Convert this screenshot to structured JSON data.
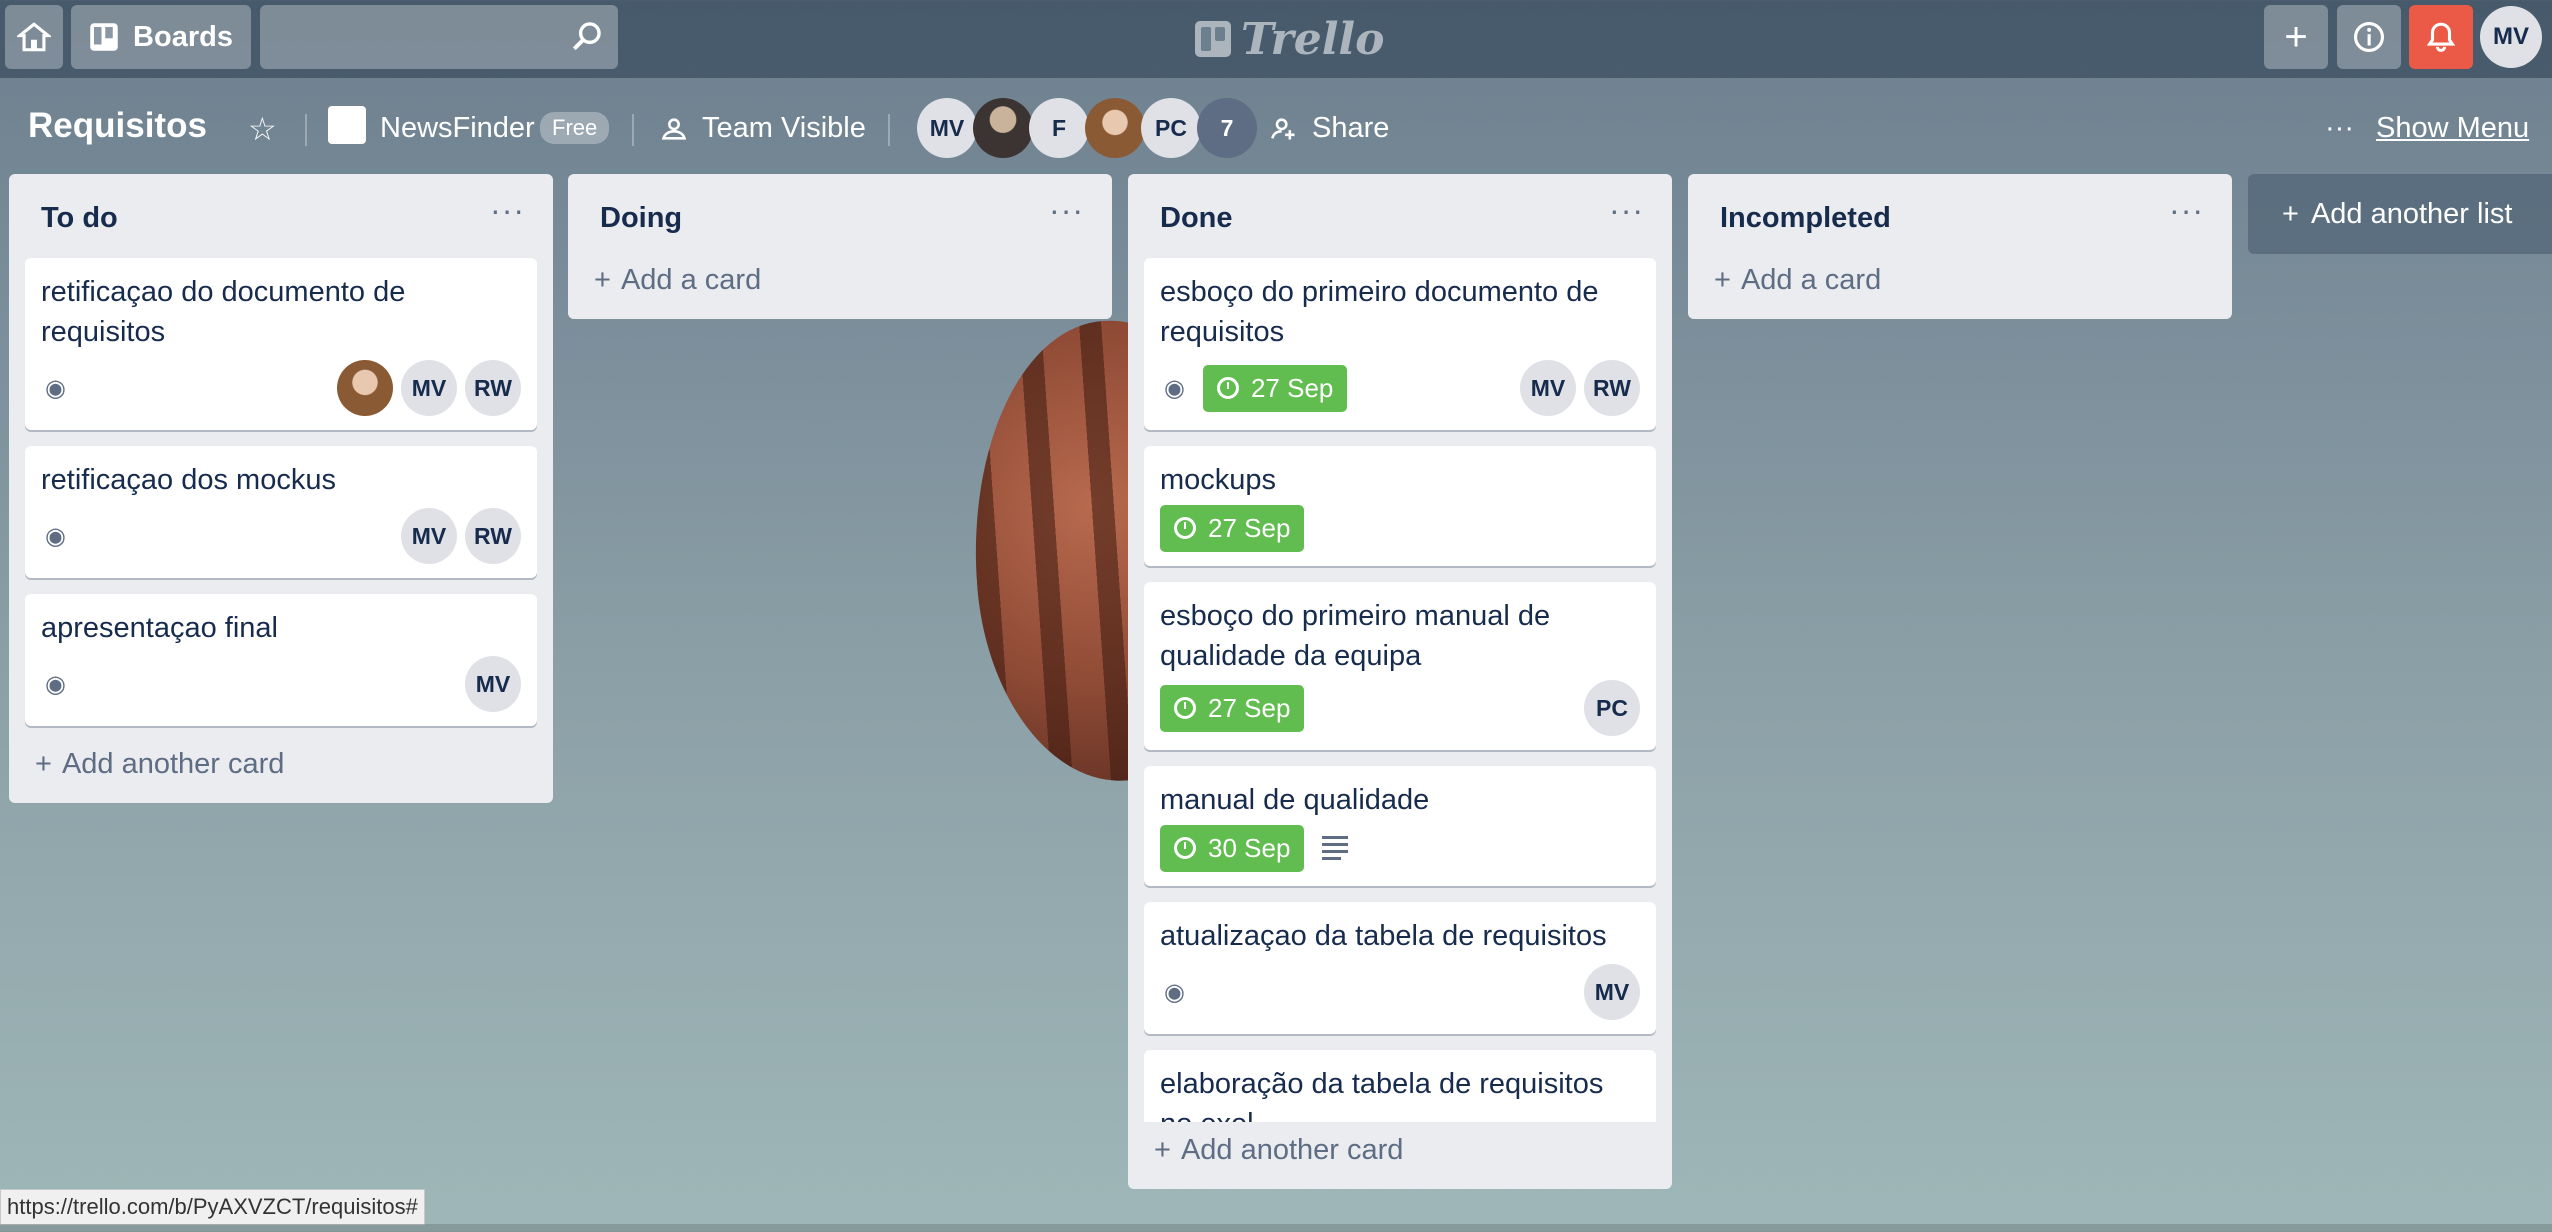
{
  "topbar": {
    "boards_label": "Boards",
    "search_value": "",
    "logo_text": "Trello",
    "user_initials": "MV"
  },
  "board": {
    "title": "Requisitos",
    "team_name": "NewsFinder",
    "plan_badge": "Free",
    "visibility": "Team Visible",
    "members": [
      "MV",
      "",
      "F",
      "",
      "PC"
    ],
    "member_count": "7",
    "share_label": "Share",
    "show_menu_label": "Show Menu"
  },
  "lists": [
    {
      "title": "To do",
      "cards": [
        {
          "title": "retificaçao do documento de requisitos",
          "watch": true,
          "due": "",
          "members": [
            "",
            "MV",
            "RW"
          ]
        },
        {
          "title": "retificaçao dos mockus",
          "watch": true,
          "due": "",
          "members": [
            "MV",
            "RW"
          ]
        },
        {
          "title": "apresentaçao final",
          "watch": true,
          "due": "",
          "members": [
            "MV"
          ]
        }
      ],
      "add_label": "Add another card"
    },
    {
      "title": "Doing",
      "cards": [],
      "add_label": "Add a card"
    },
    {
      "title": "Done",
      "cards": [
        {
          "title": "esboço do primeiro documento de requisitos",
          "watch": true,
          "due": "27 Sep",
          "members": [
            "MV",
            "RW"
          ]
        },
        {
          "title": "mockups",
          "watch": false,
          "due": "27 Sep",
          "members": []
        },
        {
          "title": "esboço do primeiro manual de qualidade da equipa",
          "watch": false,
          "due": "27 Sep",
          "members": [
            "PC"
          ]
        },
        {
          "title": "manual de qualidade",
          "watch": false,
          "due": "30 Sep",
          "description": true,
          "members": []
        },
        {
          "title": "atualizaçao da tabela de requisitos",
          "watch": true,
          "due": "",
          "members": [
            "MV"
          ]
        },
        {
          "title": "elaboração da tabela de requisitos no exel",
          "watch": false,
          "due": "",
          "members": []
        }
      ],
      "add_label": "Add another card"
    },
    {
      "title": "Incompleted",
      "cards": [],
      "add_label": "Add a card"
    }
  ],
  "add_list_label": "Add another list",
  "status_url": "https://trello.com/b/PyAXVZCT/requisitos#",
  "colors": {
    "due_green": "#61bd4f",
    "bell_red": "#eb5a46",
    "list_bg": "#ebecf0"
  }
}
